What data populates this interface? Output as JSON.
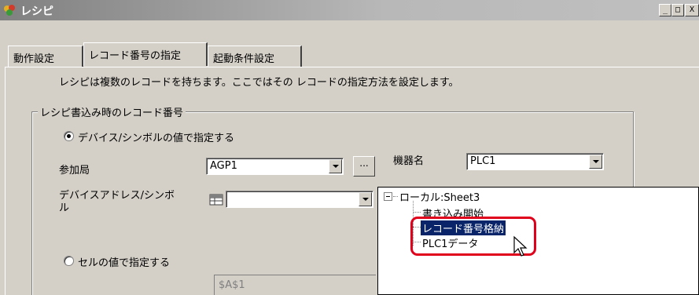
{
  "window": {
    "title": "レシピ",
    "minimize": "_",
    "maximize": "□",
    "close": "X"
  },
  "tabs": [
    {
      "label": "動作設定",
      "active": false
    },
    {
      "label": "レコード番号の指定",
      "active": true
    },
    {
      "label": "起動条件設定",
      "active": false
    }
  ],
  "description": "レシピは複数のレコードを持ちます。ここではその レコードの指定方法を設定します。",
  "group": {
    "legend": "レシピ書込み時のレコード番号",
    "radio_device": {
      "label": "デバイス/シンボルの値で指定する",
      "selected": true
    },
    "station": {
      "label": "参加局",
      "value": "AGP1",
      "ellipsis": "..."
    },
    "device_name": {
      "label": "機器名",
      "value": "PLC1"
    },
    "address": {
      "label_line1": "デバイスアドレス/シンボ",
      "label_line2": "ル",
      "value": ""
    },
    "radio_cell": {
      "label": "セルの値で指定する",
      "selected": false
    },
    "cell_value": "$A$1"
  },
  "tree": {
    "root": "ローカル:Sheet3",
    "items": [
      "書き込み開始",
      "レコード番号格納",
      "PLC1データ"
    ],
    "selected_index": 1
  },
  "colors": {
    "face": "#d4d0c8",
    "selection": "#0a246a",
    "highlight": "#e0001b"
  }
}
